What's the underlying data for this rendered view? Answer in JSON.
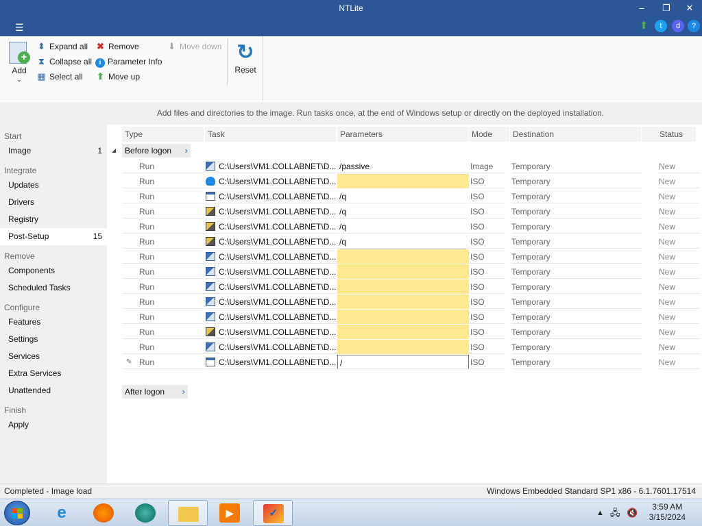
{
  "window": {
    "title": "NTLite",
    "minimize": "–",
    "restore": "❐",
    "close": "✕",
    "menu_icon": "☰"
  },
  "titlebar_icons": {
    "update": "⬆",
    "twitter": "t",
    "discord": "d",
    "help": "?"
  },
  "ribbon": {
    "add_label": "Add",
    "expand_all": "Expand all",
    "collapse_all": "Collapse all",
    "select_all": "Select all",
    "remove": "Remove",
    "parameter_info": "Parameter Info",
    "move_up": "Move up",
    "move_down": "Move down",
    "reset": "Reset",
    "colors": {
      "accent": "#2b5797",
      "reset_icon": "#1f78c1",
      "remove_icon": "#d32f2f",
      "move_up_icon": "#4caf50"
    }
  },
  "info_text": "Add files and directories to the image. Run tasks once, at the end of Windows setup or directly on the deployed installation.",
  "sidebar": {
    "start_head": "Start",
    "image": {
      "label": "Image",
      "count": "1"
    },
    "integrate_head": "Integrate",
    "updates": "Updates",
    "drivers": "Drivers",
    "registry": "Registry",
    "post_setup": {
      "label": "Post-Setup",
      "count": "15"
    },
    "remove_head": "Remove",
    "components": "Components",
    "scheduled_tasks": "Scheduled Tasks",
    "configure_head": "Configure",
    "features": "Features",
    "settings": "Settings",
    "services": "Services",
    "extra_services": "Extra Services",
    "unattended": "Unattended",
    "finish_head": "Finish",
    "apply": "Apply"
  },
  "columns": {
    "type": "Type",
    "task": "Task",
    "parameters": "Parameters",
    "mode": "Mode",
    "destination": "Destination",
    "status": "Status"
  },
  "groups": {
    "before_logon": "Before logon",
    "after_logon": "After logon"
  },
  "rows": [
    {
      "type": "Run",
      "icon": "setup-icon",
      "task": "C:\\Users\\VM1.COLLABNET\\D...",
      "parameters": "/passive",
      "highlight": false,
      "mode": "Image",
      "destination": "Temporary",
      "status": "New"
    },
    {
      "type": "Run",
      "icon": "cloud-icon",
      "task": "C:\\Users\\VM1.COLLABNET\\D...",
      "parameters": "",
      "highlight": true,
      "mode": "ISO",
      "destination": "Temporary",
      "status": "New"
    },
    {
      "type": "Run",
      "icon": "window-icon",
      "task": "C:\\Users\\VM1.COLLABNET\\D...",
      "parameters": "/q",
      "highlight": false,
      "mode": "ISO",
      "destination": "Temporary",
      "status": "New"
    },
    {
      "type": "Run",
      "icon": "certificate-icon",
      "task": "C:\\Users\\VM1.COLLABNET\\D...",
      "parameters": "/q",
      "highlight": false,
      "mode": "ISO",
      "destination": "Temporary",
      "status": "New"
    },
    {
      "type": "Run",
      "icon": "certificate-icon",
      "task": "C:\\Users\\VM1.COLLABNET\\D...",
      "parameters": "/q",
      "highlight": false,
      "mode": "ISO",
      "destination": "Temporary",
      "status": "New"
    },
    {
      "type": "Run",
      "icon": "certificate-icon",
      "task": "C:\\Users\\VM1.COLLABNET\\D...",
      "parameters": "/q",
      "highlight": false,
      "mode": "ISO",
      "destination": "Temporary",
      "status": "New"
    },
    {
      "type": "Run",
      "icon": "setup-icon",
      "task": "C:\\Users\\VM1.COLLABNET\\D...",
      "parameters": "",
      "highlight": true,
      "mode": "ISO",
      "destination": "Temporary",
      "status": "New"
    },
    {
      "type": "Run",
      "icon": "setup-icon",
      "task": "C:\\Users\\VM1.COLLABNET\\D...",
      "parameters": "",
      "highlight": true,
      "mode": "ISO",
      "destination": "Temporary",
      "status": "New"
    },
    {
      "type": "Run",
      "icon": "setup-icon",
      "task": "C:\\Users\\VM1.COLLABNET\\D...",
      "parameters": "",
      "highlight": true,
      "mode": "ISO",
      "destination": "Temporary",
      "status": "New"
    },
    {
      "type": "Run",
      "icon": "setup-icon",
      "task": "C:\\Users\\VM1.COLLABNET\\D...",
      "parameters": "",
      "highlight": true,
      "mode": "ISO",
      "destination": "Temporary",
      "status": "New"
    },
    {
      "type": "Run",
      "icon": "setup-icon",
      "task": "C:\\Users\\VM1.COLLABNET\\D...",
      "parameters": "",
      "highlight": true,
      "mode": "ISO",
      "destination": "Temporary",
      "status": "New"
    },
    {
      "type": "Run",
      "icon": "certificate-icon",
      "task": "C:\\Users\\VM1.COLLABNET\\D...",
      "parameters": "",
      "highlight": true,
      "mode": "ISO",
      "destination": "Temporary",
      "status": "New"
    },
    {
      "type": "Run",
      "icon": "setup-icon",
      "task": "C:\\Users\\VM1.COLLABNET\\D...",
      "parameters": "",
      "highlight": true,
      "mode": "ISO",
      "destination": "Temporary",
      "status": "New"
    },
    {
      "type": "Run",
      "icon": "window-icon",
      "task": "C:\\Users\\VM1.COLLABNET\\D...",
      "parameters": "/",
      "highlight": false,
      "editing": true,
      "mode": "ISO",
      "destination": "Temporary",
      "status": "New"
    }
  ],
  "statusbar": {
    "left": "Completed - Image load",
    "right": "Windows Embedded Standard SP1 x86 - 6.1.7601.17514"
  },
  "taskbar": {
    "apps": [
      "internet-explorer-icon",
      "firefox-icon",
      "app-icon",
      "file-explorer-icon",
      "media-player-icon",
      "ntlite-icon"
    ],
    "time": "3:59 AM",
    "date": "3/15/2024"
  }
}
